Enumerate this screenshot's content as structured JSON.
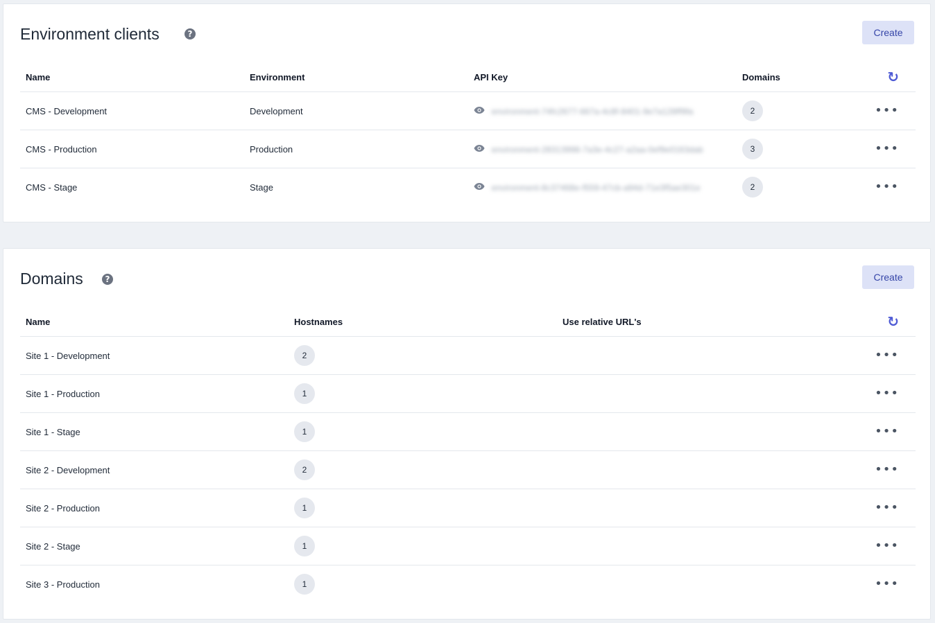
{
  "colors": {
    "accent": "#4f5bd5",
    "button_bg": "#dde2f7",
    "badge_bg": "#e5e8ee",
    "page_bg": "#eef1f5"
  },
  "environment_clients": {
    "title": "Environment clients",
    "help_icon": "question-circle-icon",
    "create_label": "Create",
    "columns": [
      "Name",
      "Environment",
      "API Key",
      "Domains"
    ],
    "refresh_icon": "refresh-icon",
    "rows": [
      {
        "name": "CMS - Development",
        "environment": "Development",
        "api_key": "environment-74fc2677-667a-4c8f-8401-9e7a128ff9fa",
        "domains": "2"
      },
      {
        "name": "CMS - Production",
        "environment": "Production",
        "api_key": "environment-28313998-7a3e-4c27-a2aa-0ef9e0163dab",
        "domains": "3"
      },
      {
        "name": "CMS - Stage",
        "environment": "Stage",
        "api_key": "environment-8c37468e-f559-47cb-a94d-71e3f5ae301e",
        "domains": "2"
      }
    ]
  },
  "domains": {
    "title": "Domains",
    "help_icon": "question-circle-icon",
    "create_label": "Create",
    "columns": [
      "Name",
      "Hostnames",
      "Use relative URL's"
    ],
    "refresh_icon": "refresh-icon",
    "rows": [
      {
        "name": "Site 1 - Development",
        "hostnames": "2"
      },
      {
        "name": "Site 1 - Production",
        "hostnames": "1"
      },
      {
        "name": "Site 1 - Stage",
        "hostnames": "1"
      },
      {
        "name": "Site 2 - Development",
        "hostnames": "2"
      },
      {
        "name": "Site 2 - Production",
        "hostnames": "1"
      },
      {
        "name": "Site 2 - Stage",
        "hostnames": "1"
      },
      {
        "name": "Site 3 - Production",
        "hostnames": "1"
      }
    ]
  },
  "row_actions_icon": "more-horizontal-icon"
}
